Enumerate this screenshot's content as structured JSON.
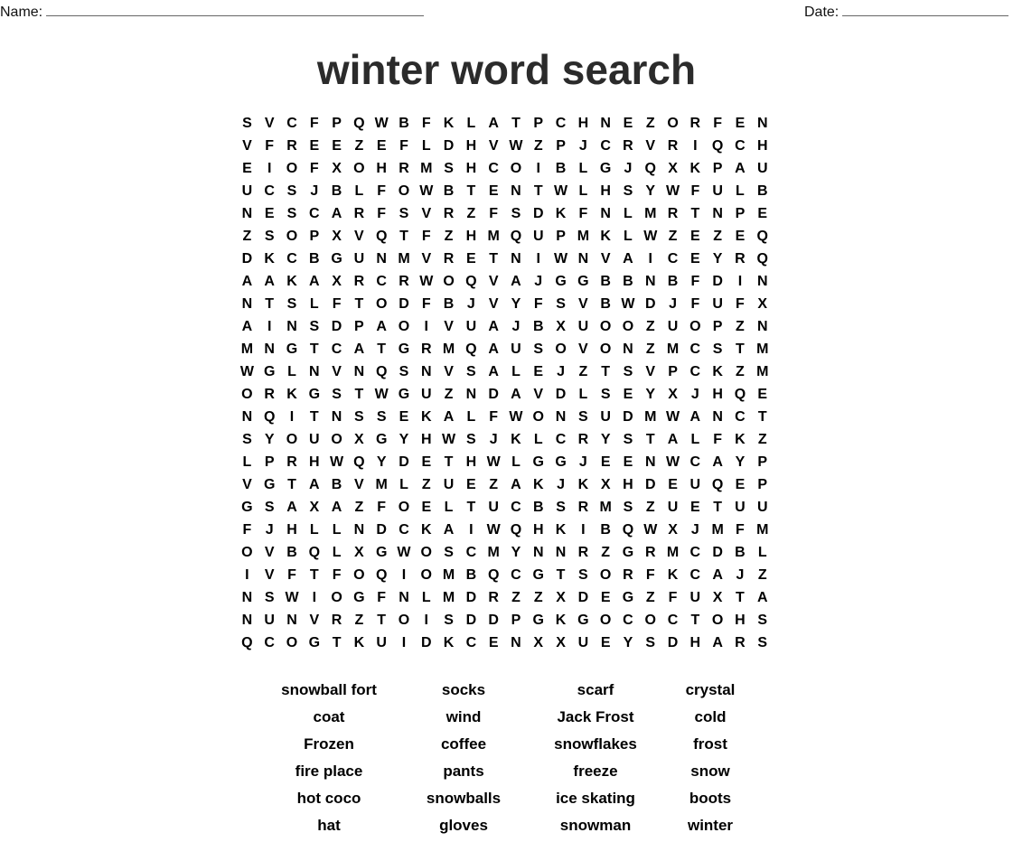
{
  "header": {
    "name_label": "Name:",
    "date_label": "Date:"
  },
  "title": "winter word search",
  "grid": [
    "SVCFPQWBFKLATPCHNEZORFEN",
    "VFREEZEFLDHVWZPJCRVRIQCH",
    "EIOFXOHRMSHCOIBLGJQXKPAU",
    "UCSJBLFOWBTENTWLHSYWFULB",
    "NESCARFSVRZFSDKFNLMRTNPE",
    "ZSOPXVQTFZHMQUPMKLWZEZEQ",
    "DKCBGUNMVRETNIWNVAICEYRQ",
    "AAKAXRCRWOQVAJGGBBNBFDIN",
    "NTSLFTODFBJVYFSVBWDJFUFX",
    "AINSDPAOIVUAJBXUOOZUOPZN",
    "MNGTCATGRMQAUSOVONZMCSTM",
    "WGLNVNQSNVSALEJZTSVPCKZM",
    "ORKGSTWGUZNDAVDLSEYXJHQE",
    "NQITNSSEKALFWONSUDMWANCT",
    "SYOUOXGYHWSJKLCRYSTALFKZ",
    "LPRHWQYDETHWLGGJEENWCAYP",
    "VGTABVMLZUEZAKJKXHDEUQEP",
    "GSAXAZFOELTUCBSRMSZUETUU",
    "FJHLLNDCKAIWQHKIBQWXJMFM",
    "OVBQLXGWOSCMYNNRZGRMCDBL",
    "IVFTFOQIOMBQCGTSORFKCAJZ",
    "NSWIOGFNLMDRZZXDEGZFUXTA",
    "NUNVRZTOISDDPGKGOCOCTOHS",
    "QCOGTKUIDKCENXXUEYSDHARS"
  ],
  "words": [
    "snowball fort",
    "socks",
    "scarf",
    "crystal",
    "coat",
    "wind",
    "Jack Frost",
    "cold",
    "Frozen",
    "coffee",
    "snowflakes",
    "frost",
    "fire place",
    "pants",
    "freeze",
    "snow",
    "hot coco",
    "snowballs",
    "ice skating",
    "boots",
    "hat",
    "gloves",
    "snowman",
    "winter"
  ]
}
